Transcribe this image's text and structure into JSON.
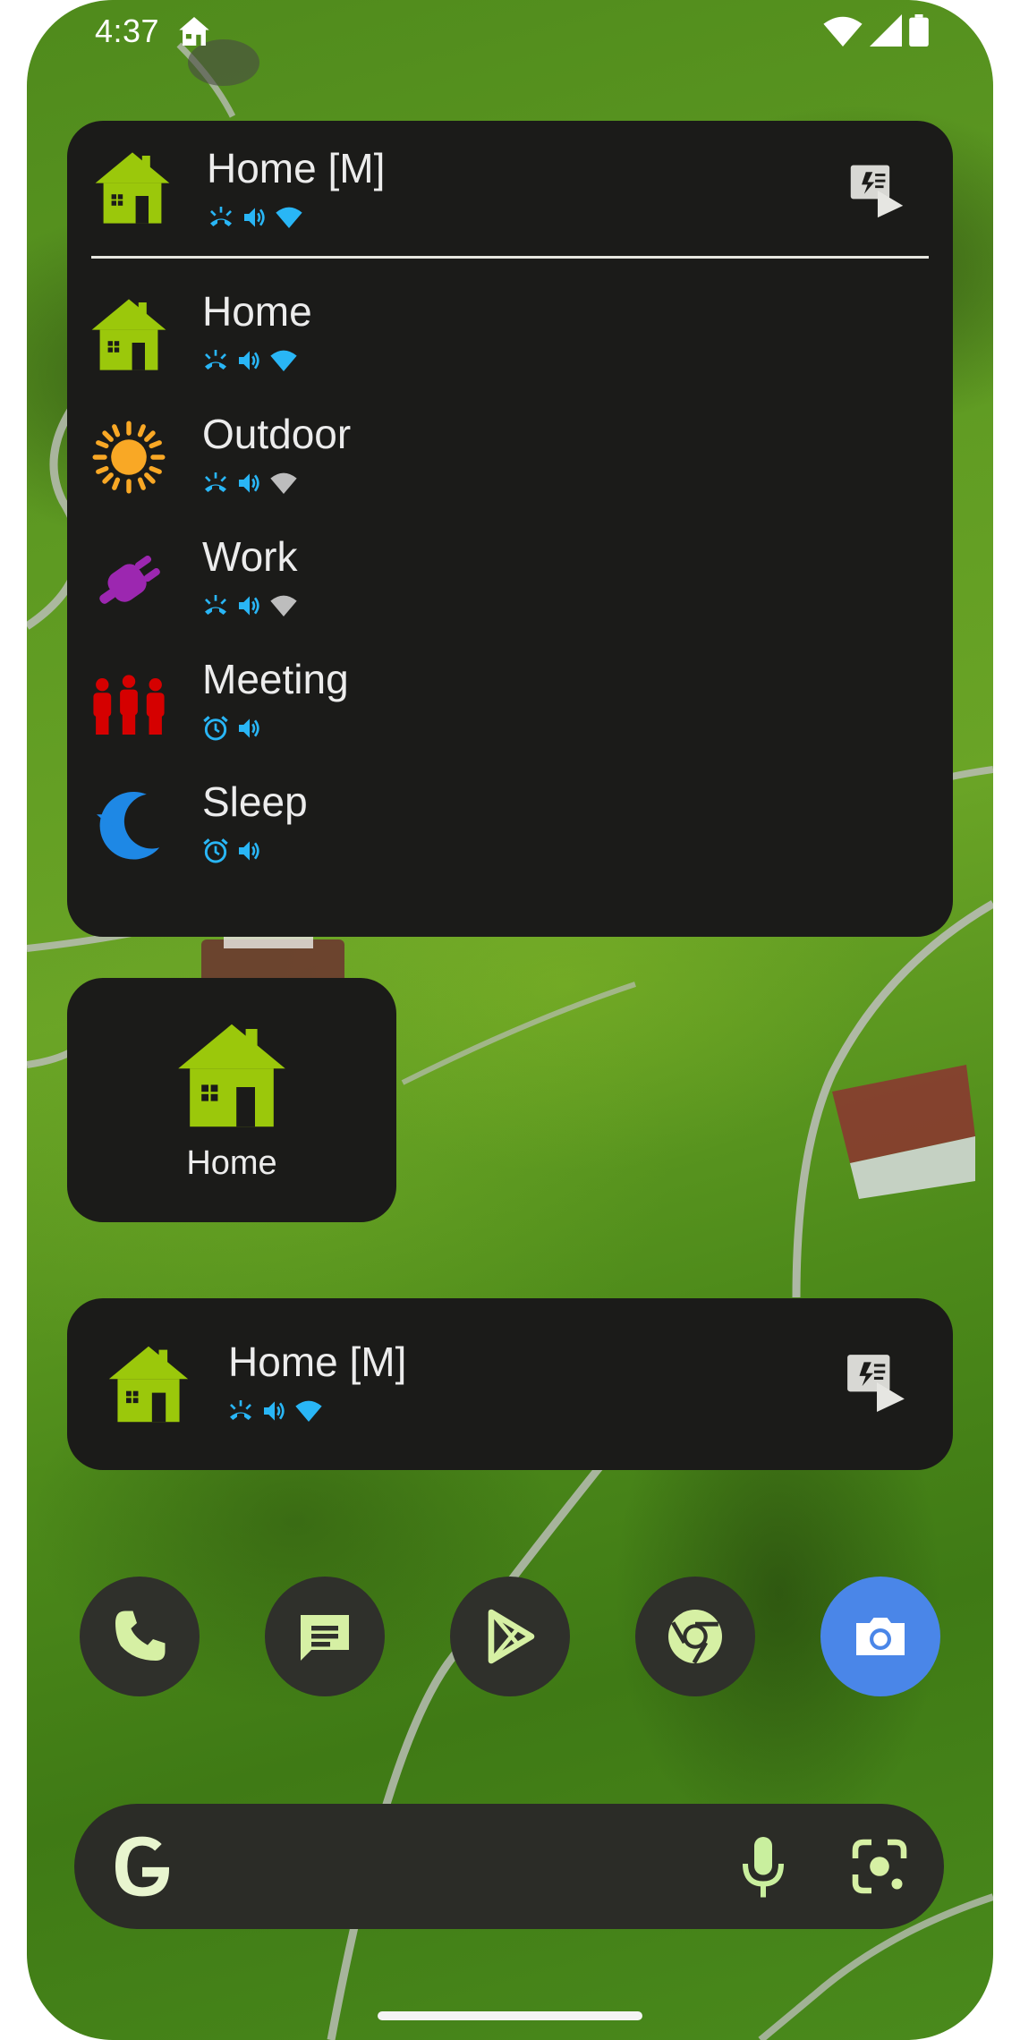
{
  "status_bar": {
    "time": "4:37"
  },
  "list_widget": {
    "active_profile": {
      "name": "Home [M]",
      "icon": "home-icon",
      "status_icons": [
        "ringer-icon",
        "volume-icon",
        "wifi-on-icon"
      ]
    },
    "profiles": [
      {
        "name": "Home",
        "icon": "home-icon",
        "status_icons": [
          "ringer-icon",
          "volume-icon",
          "wifi-on-icon"
        ]
      },
      {
        "name": "Outdoor",
        "icon": "sun-icon",
        "status_icons": [
          "ringer-icon",
          "volume-icon",
          "wifi-off-icon"
        ]
      },
      {
        "name": "Work",
        "icon": "plug-icon",
        "status_icons": [
          "ringer-icon",
          "volume-icon",
          "wifi-off-icon"
        ]
      },
      {
        "name": "Meeting",
        "icon": "people-icon",
        "status_icons": [
          "alarm-icon",
          "volume-icon"
        ]
      },
      {
        "name": "Sleep",
        "icon": "moon-icon",
        "status_icons": [
          "alarm-icon",
          "volume-icon"
        ]
      }
    ],
    "action_icon": "activate-profile-icon"
  },
  "single_widget": {
    "label": "Home",
    "icon": "home-icon"
  },
  "bar_widget": {
    "name": "Home [M]",
    "icon": "home-icon",
    "status_icons": [
      "ringer-icon",
      "volume-icon",
      "wifi-on-icon"
    ],
    "action_icon": "activate-profile-icon"
  },
  "dock": [
    "phone-app",
    "messages-app",
    "play-store-app",
    "chrome-app",
    "camera-app"
  ],
  "search": {
    "icons": [
      "google-logo",
      "mic-icon",
      "lens-icon"
    ]
  },
  "colors": {
    "widget_bg": "#1b1b19",
    "home_green": "#9bc80b",
    "status_blue": "#29b6f6",
    "wifi_grey": "#bdbdbd",
    "sun_orange": "#f9a825",
    "work_purple": "#9c27b0",
    "meeting_red": "#d50000",
    "sleep_blue": "#1e88e5"
  }
}
